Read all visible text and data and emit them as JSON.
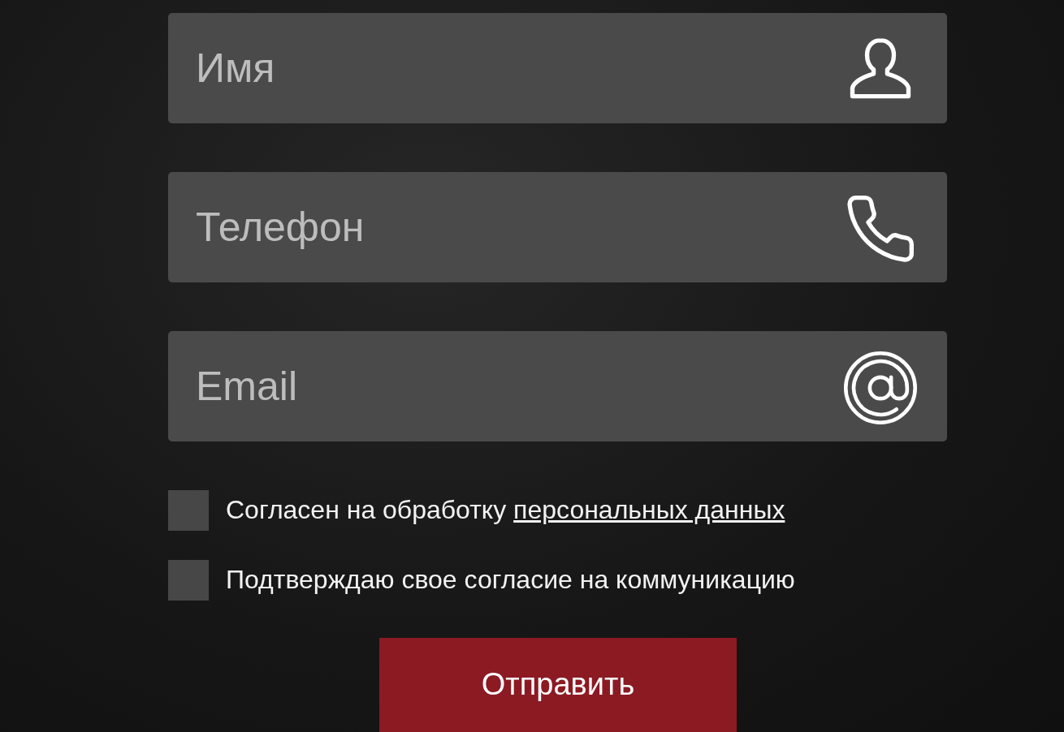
{
  "fields": [
    {
      "placeholder": "Имя",
      "kind": "person"
    },
    {
      "placeholder": "Телефон",
      "kind": "phone"
    },
    {
      "placeholder": "Email",
      "kind": "email"
    }
  ],
  "consents": [
    {
      "text": "Согласен на обработку ",
      "link": "персональных данных",
      "checked": false
    },
    {
      "text": "Подтверждаю свое согласие на коммуникацию",
      "checked": false
    }
  ],
  "submit": {
    "label": "Отправить"
  }
}
